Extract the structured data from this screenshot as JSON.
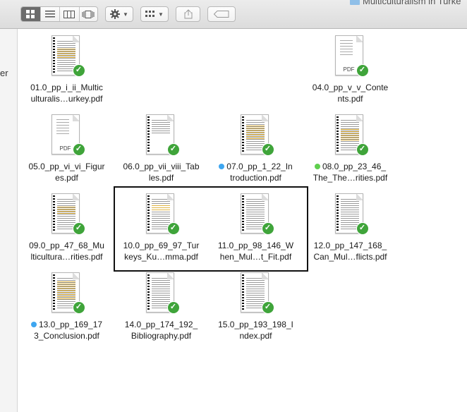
{
  "window": {
    "title": "Multiculturalism in Turke"
  },
  "sidebar": {
    "fragment_text": "er"
  },
  "toolbar": {
    "view_icons": [
      "icon-view-icon",
      "list-view-icon",
      "column-view-icon",
      "cover-flow-view-icon"
    ],
    "action_icon": "gear-icon",
    "arrange_icon": "arrange-grid-icon",
    "share_icon": "share-icon",
    "tag_icon": "tag-icon"
  },
  "colors": {
    "check": "#3fa43a",
    "tag_blue": "#3ea6f0",
    "tag_green": "#5fcf4e",
    "highlight": "#e0b340"
  },
  "files": [
    {
      "line1": "01.0_pp_i_ii_Multic",
      "line2": "ulturalis…urkey.pdf",
      "tag": ""
    },
    {
      "line1": "04.0_pp_v_v_Conte",
      "line2": "nts.pdf",
      "tag": ""
    },
    {
      "line1": "05.0_pp_vi_vi_Figur",
      "line2": "es.pdf",
      "tag": ""
    },
    {
      "line1": "06.0_pp_vii_viii_Tab",
      "line2": "les.pdf",
      "tag": ""
    },
    {
      "line1": "07.0_pp_1_22_In",
      "line2": "troduction.pdf",
      "tag": "blue"
    },
    {
      "line1": "08.0_pp_23_46_",
      "line2": "The_The…rities.pdf",
      "tag": "green"
    },
    {
      "line1": "09.0_pp_47_68_Mu",
      "line2": "lticultura…rities.pdf",
      "tag": ""
    },
    {
      "line1": "10.0_pp_69_97_Tur",
      "line2": "keys_Ku…mma.pdf",
      "tag": ""
    },
    {
      "line1": "11.0_pp_98_146_W",
      "line2": "hen_Mul…t_Fit.pdf",
      "tag": ""
    },
    {
      "line1": "12.0_pp_147_168_",
      "line2": "Can_Mul…flicts.pdf",
      "tag": ""
    },
    {
      "line1": "13.0_pp_169_17",
      "line2": "3_Conclusion.pdf",
      "tag": "blue"
    },
    {
      "line1": "14.0_pp_174_192_",
      "line2": "Bibliography.pdf",
      "tag": ""
    },
    {
      "line1": "15.0_pp_193_198_I",
      "line2": "ndex.pdf",
      "tag": ""
    }
  ],
  "pdf_badge": "PDF",
  "check_glyph": "✓"
}
